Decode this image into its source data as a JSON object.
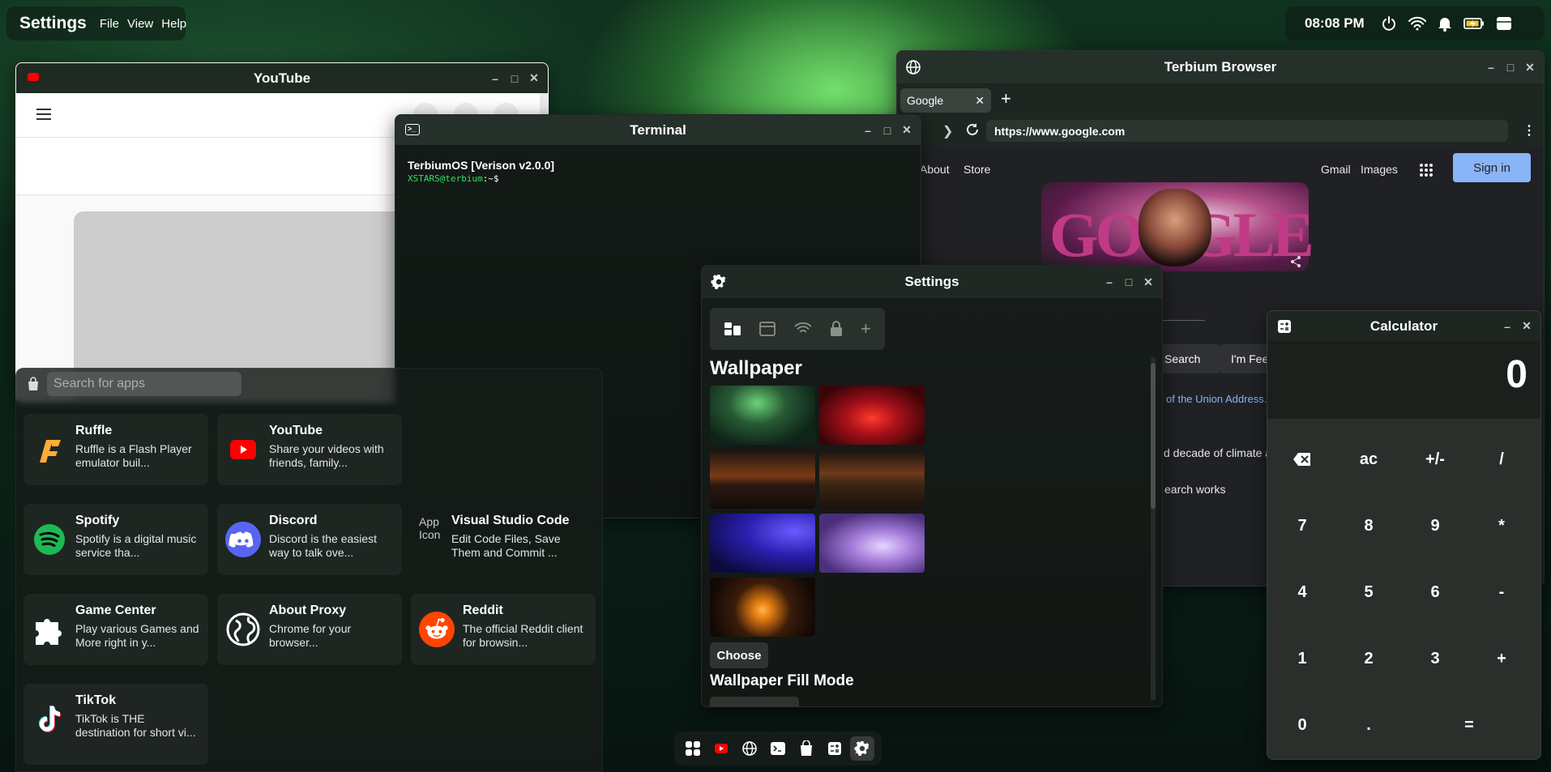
{
  "topbar": {
    "app_name": "Settings",
    "menus": [
      "File",
      "View",
      "Help"
    ],
    "clock": "08:08 PM"
  },
  "youtube": {
    "title": "YouTube"
  },
  "terminal": {
    "title": "Terminal",
    "line1": "TerbiumOS [Verison v2.0.0]",
    "prompt_user": "XSTARS@terbium",
    "prompt_path": ":~$"
  },
  "browser": {
    "title": "Terbium Browser",
    "tab": "Google",
    "url": "https://www.google.com",
    "nav_about": "About",
    "nav_store": "Store",
    "gmail": "Gmail",
    "images": "Images",
    "sign_in": "Sign in",
    "search_btn": "Search",
    "lucky_btn": "I'm Fee",
    "link_text": "of the Union Address.",
    "line2": "d decade of climate a",
    "line3": "earch works",
    "doodle": "GOOGLE"
  },
  "settings": {
    "title": "Settings",
    "section": "Wallpaper",
    "choose": "Choose",
    "fill_mode": "Wallpaper Fill Mode"
  },
  "calculator": {
    "title": "Calculator",
    "display": "0",
    "keys": [
      "ac",
      "+/-",
      "/",
      "7",
      "8",
      "9",
      "*",
      "4",
      "5",
      "6",
      "-",
      "1",
      "2",
      "3",
      "+",
      "0",
      ".",
      "="
    ]
  },
  "launcher": {
    "search_placeholder": "Search for apps",
    "apps": [
      {
        "name": "Ruffle",
        "desc": "Ruffle is a Flash Player emulator buil..."
      },
      {
        "name": "YouTube",
        "desc": "Share your videos with friends, family..."
      },
      {
        "name": "Spotify",
        "desc": "Spotify is a digital music service tha..."
      },
      {
        "name": "Discord",
        "desc": "Discord is the easiest way to talk ove..."
      },
      {
        "name": "Visual Studio Code",
        "desc": "Edit Code Files, Save Them and Commit ...",
        "alt": "App Icon"
      },
      {
        "name": "Game Center",
        "desc": "Play various Games and More right in y..."
      },
      {
        "name": "About Proxy",
        "desc": "Chrome for your browser..."
      },
      {
        "name": "Reddit",
        "desc": "The official Reddit client for browsin..."
      },
      {
        "name": "TikTok",
        "desc": "TikTok is THE destination for short vi..."
      }
    ]
  },
  "colors": {
    "accent": "#8ab4f8",
    "youtube_red": "#ff0000",
    "spotify": "#1db954",
    "discord": "#5865f2",
    "reddit": "#ff4500"
  }
}
